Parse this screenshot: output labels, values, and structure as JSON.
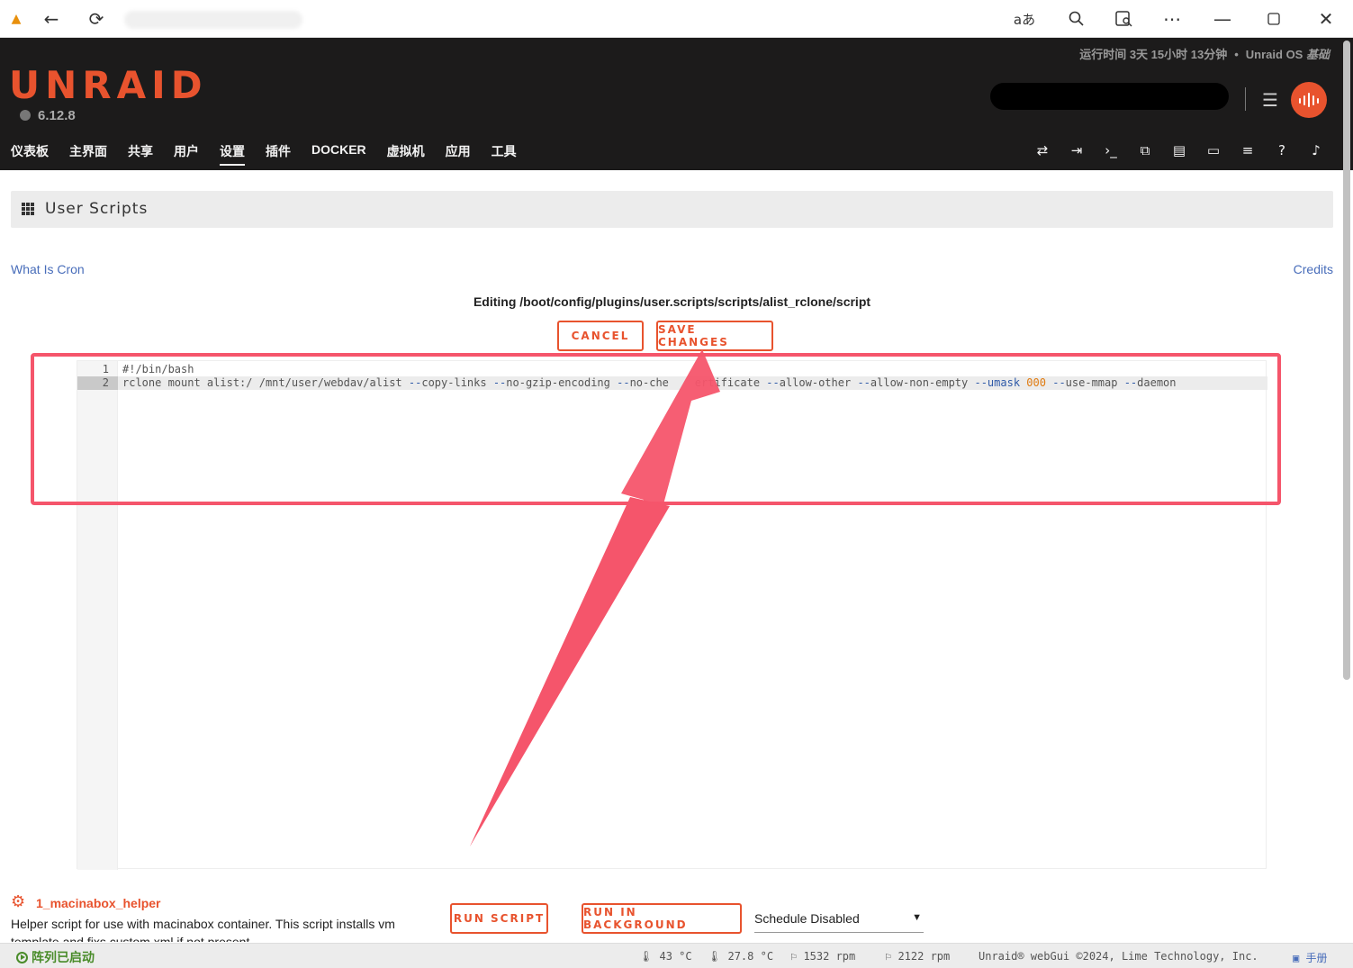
{
  "browser": {
    "nav_icons": [
      "back-icon",
      "refresh-icon"
    ],
    "tool_icons": [
      "translate-icon",
      "zoom-icon",
      "reader-icon",
      "more-icon",
      "minimize-icon",
      "maximize-icon",
      "close-icon"
    ],
    "translate_label": "aあ"
  },
  "header": {
    "logo": "UNRAID",
    "version": "6.12.8",
    "uptime": "运行时间 3天 15小时 13分钟",
    "os_label": "Unraid OS",
    "os_edition": "基础",
    "nav": [
      "仪表板",
      "主界面",
      "共享",
      "用户",
      "设置",
      "插件",
      "DOCKER",
      "虚拟机",
      "应用",
      "工具"
    ],
    "active_nav": "设置"
  },
  "page": {
    "title": "User Scripts",
    "what_is_cron": "What Is Cron",
    "credits": "Credits",
    "editing": "Editing /boot/config/plugins/user.scripts/scripts/alist_rclone/script",
    "cancel": "CANCEL",
    "save": "SAVE CHANGES"
  },
  "editor": {
    "lines": [
      {
        "num": "1",
        "text": "#!/bin/bash"
      },
      {
        "num": "2",
        "text": "rclone mount alist:/ /mnt/user/webdav/alist --copy-links --no-gzip-encoding --no-check-certificate --allow-other --allow-non-empty --umask 000 --use-mmap --daemon"
      }
    ],
    "obscured_line2_visible": "rclone mount alist:/ /mnt/user/webdav/alist --copy-links --no-gzip-encoding --no-che"
  },
  "script": {
    "name": "1_macinabox_helper",
    "description": "Helper script for use with macinabox container. This script installs vm template and fixs custom xml if not present",
    "run": "RUN SCRIPT",
    "run_bg": "RUN IN BACKGROUND",
    "schedule": "Schedule Disabled"
  },
  "footer": {
    "array": "阵列已启动",
    "cpu_temp": "43 °C",
    "mb_temp": "27.8 °C",
    "fan1": "1532 rpm",
    "fan2": "2122 rpm",
    "copyright": "Unraid® webGui ©2024, Lime Technology, Inc.",
    "manual": "手册"
  },
  "colors": {
    "accent": "#e8532e",
    "annotation": "#f5556b",
    "header_bg": "#1c1b1b",
    "link": "#486dba"
  }
}
